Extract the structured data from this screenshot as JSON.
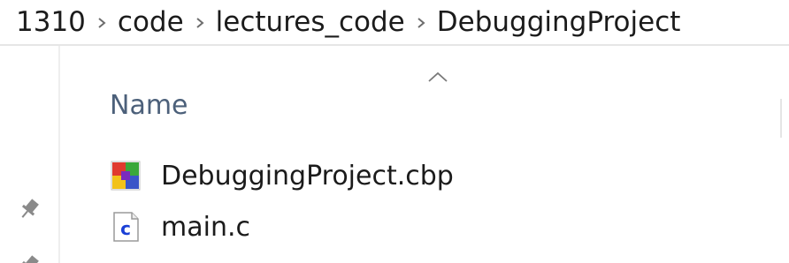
{
  "breadcrumb": {
    "items": [
      "1310",
      "code",
      "lectures_code",
      "DebuggingProject"
    ]
  },
  "columns": {
    "name_label": "Name",
    "sort_direction": "ascending"
  },
  "files": [
    {
      "name": "DebuggingProject.cbp",
      "icon": "codeblocks-project-icon"
    },
    {
      "name": "main.c",
      "icon": "c-source-file-icon"
    }
  ],
  "colors": {
    "header_text": "#4c607a",
    "text": "#1b1b1b",
    "c_icon_blue": "#1a3fd6"
  }
}
